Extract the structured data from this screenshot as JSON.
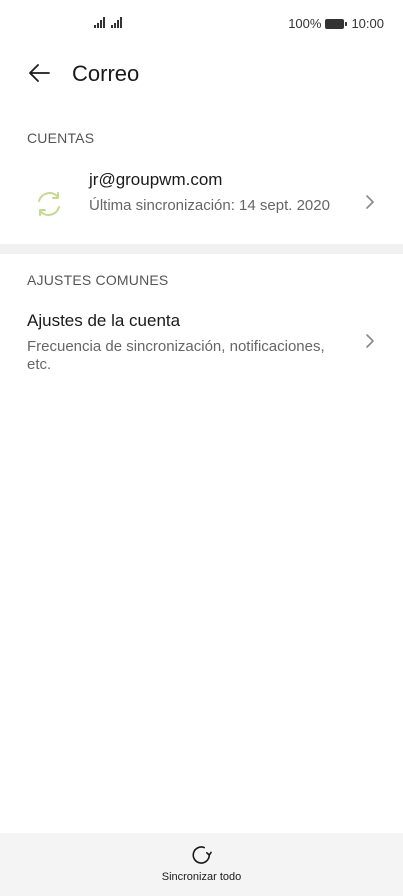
{
  "status_bar": {
    "battery_percent": "100%",
    "time": "10:00"
  },
  "app_bar": {
    "title": "Correo"
  },
  "accounts_section": {
    "header": "CUENTAS",
    "account": {
      "email": "jr@groupwm.com",
      "last_sync": "Última sincronización: 14 sept. 2020"
    }
  },
  "common_section": {
    "header": "AJUSTES COMUNES",
    "account_settings": {
      "title": "Ajustes de la cuenta",
      "subtitle": "Frecuencia de sincronización, notificaciones, etc."
    }
  },
  "bottom_bar": {
    "sync_all_label": "Sincronizar todo"
  },
  "colors": {
    "sync_icon": "#c5d98a",
    "background": "#ffffff",
    "divider_band": "#f1f1f1",
    "bottom_bar": "#f4f4f4"
  },
  "icons": {
    "back": "arrow-left-icon",
    "account": "sync-icon",
    "chevron": "chevron-right-icon",
    "sync_all": "refresh-icon"
  }
}
